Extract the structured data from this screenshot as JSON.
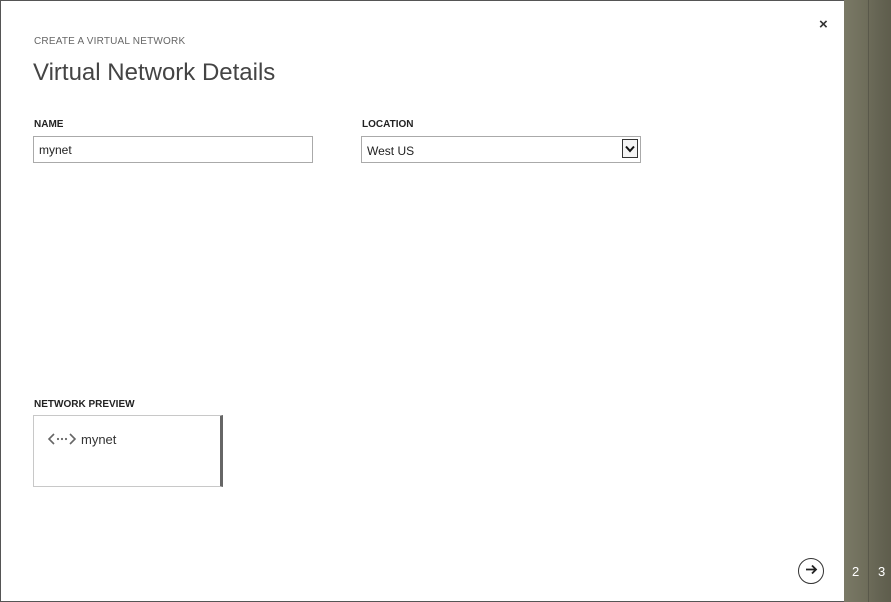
{
  "dialog": {
    "subtitle": "CREATE A VIRTUAL NETWORK",
    "title": "Virtual Network Details",
    "close_label": "×"
  },
  "fields": {
    "name": {
      "label": "NAME",
      "value": "mynet"
    },
    "location": {
      "label": "LOCATION",
      "value": "West US"
    }
  },
  "preview": {
    "label": "NETWORK PREVIEW",
    "network_name": "mynet",
    "icon": "virtual-network-icon"
  },
  "navigation": {
    "next_icon": "arrow-right-icon",
    "steps": [
      "2",
      "3"
    ]
  },
  "colors": {
    "side_strip": "#6f6e5b",
    "step_text": "#ffffff"
  }
}
